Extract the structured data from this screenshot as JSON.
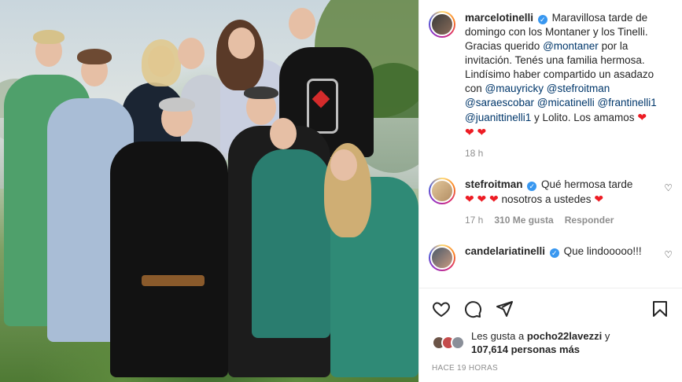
{
  "post": {
    "username": "marcelotinelli",
    "caption_pre": "Maravillosa tarde de domingo con los Montaner y los Tinelli. Gracias querido ",
    "mention_1": "@montaner",
    "caption_mid": " por la invitación. Tenés una familia hermosa. Lindísimo haber compartido un asadazo con ",
    "mentions": [
      "@mauyricky",
      "@stefroitman",
      "@saraescobar",
      "@micatinelli",
      "@frantinelli1",
      "@juanittinelli1"
    ],
    "caption_end": " y Lolito. Los amamos ",
    "time_ago": "18 h"
  },
  "comments": [
    {
      "username": "stefroitman",
      "text": "Qué hermosa tarde",
      "text2": " nosotros a ustedes ",
      "time": "17 h",
      "likes": "310 Me gusta",
      "reply": "Responder"
    },
    {
      "username": "candelariatinelli",
      "text": "Que lindooooo!!!"
    }
  ],
  "likes_line": {
    "prefix": "Les gusta a ",
    "user": "pocho22lavezzi",
    "mid": " y",
    "count": "107,614 personas más"
  },
  "timestamp": "HACE 19 HORAS",
  "icons": {
    "like": "heart-outline-icon",
    "comment": "comment-bubble-icon",
    "share": "paper-plane-icon",
    "save": "bookmark-icon",
    "verified": "verified-badge-icon"
  },
  "colors": {
    "link": "#00376b",
    "verified": "#3897f0",
    "heart": "#ed1c24",
    "muted": "#8e8e8e"
  }
}
